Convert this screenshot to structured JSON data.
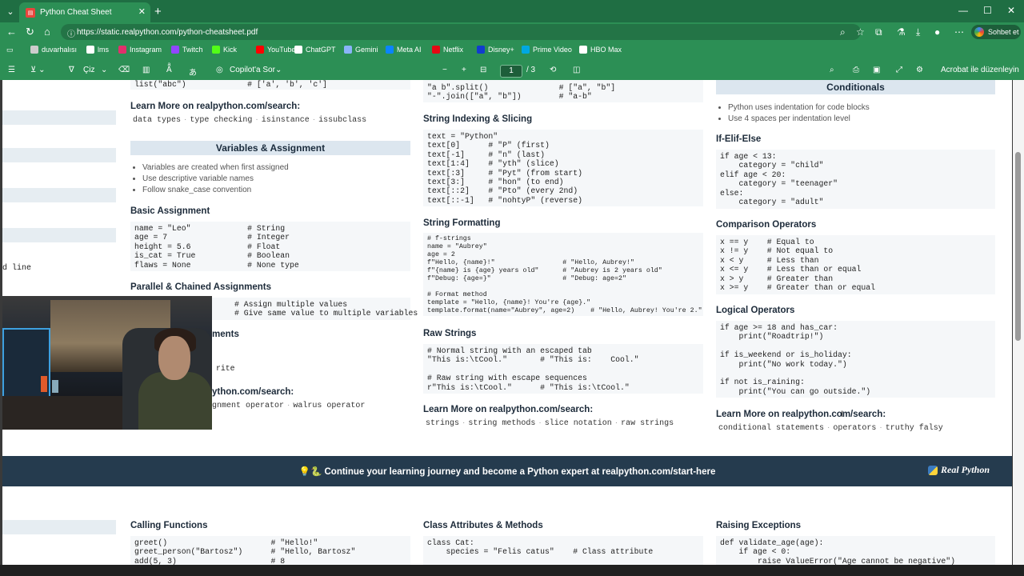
{
  "browser": {
    "tab_title": "Python Cheat Sheet",
    "url": "https://static.realpython.com/python-cheatsheet.pdf",
    "profile_label": "Sohbet et"
  },
  "bookmarks": [
    {
      "label": "duvarhalısı",
      "color": "#cccccc"
    },
    {
      "label": "lms",
      "color": "#ffffff"
    },
    {
      "label": "Instagram",
      "color": "#e1306c"
    },
    {
      "label": "Twitch",
      "color": "#9146ff"
    },
    {
      "label": "Kick",
      "color": "#53fc18"
    },
    {
      "label": "YouTube",
      "color": "#ff0000"
    },
    {
      "label": "ChatGPT",
      "color": "#ffffff"
    },
    {
      "label": "Gemini",
      "color": "#8ab4f8"
    },
    {
      "label": "Meta AI",
      "color": "#0a84ff"
    },
    {
      "label": "Netflix",
      "color": "#e50914"
    },
    {
      "label": "Disney+",
      "color": "#113ccf"
    },
    {
      "label": "Prime Video",
      "color": "#00a8e1"
    },
    {
      "label": "HBO Max",
      "color": "#ffffff"
    }
  ],
  "pdf_toolbar": {
    "draw_label": "Çiz",
    "copilot_label": "Copilot'a Sor",
    "page_current": "1",
    "page_total": "/ 3",
    "acrobat_label": "Acrobat ile düzenleyin"
  },
  "left_fragments": {
    "line_text": "d line",
    "search_fragment": "ython.com/search:",
    "ments": "ments",
    "rite": "rite",
    "tag_a": "gnment operator",
    "tag_b": "walrus operator"
  },
  "col1": {
    "top_code": "list(\"abc\")             # ['a', 'b', 'c']",
    "learn_title": "Learn More on realpython.com/search:",
    "tags": [
      "data types",
      "type checking",
      "isinstance",
      "issubclass"
    ],
    "section_title": "Variables & Assignment",
    "bullets": [
      "Variables are created when first assigned",
      "Use descriptive variable names",
      "Follow snake_case convention"
    ],
    "basic_title": "Basic Assignment",
    "basic_code": "name = \"Leo\"            # String\nage = 7                 # Integer\nheight = 5.6            # Float\nis_cat = True           # Boolean\nflaws = None            # None type",
    "parallel_title": "Parallel & Chained Assignments",
    "parallel_code": "# Assign multiple values\n# Give same value to multiple variables"
  },
  "col2": {
    "top_code": "\"a b\".split()               # [\"a\", \"b\"]\n\"-\".join([\"a\", \"b\"])        # \"a-b\"",
    "index_title": "String Indexing & Slicing",
    "index_code": "text = \"Python\"\ntext[0]      # \"P\" (first)\ntext[-1]     # \"n\" (last)\ntext[1:4]    # \"yth\" (slice)\ntext[:3]     # \"Pyt\" (from start)\ntext[3:]     # \"hon\" (to end)\ntext[::2]    # \"Pto\" (every 2nd)\ntext[::-1]   # \"nohtyP\" (reverse)",
    "format_title": "String Formatting",
    "format_code": "# f-strings\nname = \"Aubrey\"\nage = 2\nf\"Hello, {name}!\"                 # \"Hello, Aubrey!\"\nf\"{name} is {age} years old\"      # \"Aubrey is 2 years old\"\nf\"Debug: {age=}\"                  # \"Debug: age=2\"\n\n# Format method\ntemplate = \"Hello, {name}! You're {age}.\"\ntemplate.format(name=\"Aubrey\", age=2)    # \"Hello, Aubrey! You're 2.\"",
    "raw_title": "Raw Strings",
    "raw_code": "# Normal string with an escaped tab\n\"This is:\\tCool.\"       # \"This is:    Cool.\"\n\n# Raw string with escape sequences\nr\"This is:\\tCool.\"      # \"This is:\\tCool.\"",
    "learn_title": "Learn More on realpython.com/search:",
    "tags": [
      "strings",
      "string methods",
      "slice notation",
      "raw strings"
    ]
  },
  "col3": {
    "section_title": "Conditionals",
    "bullets": [
      "Python uses indentation for code blocks",
      "Use 4 spaces per indentation level"
    ],
    "ifelse_title": "If-Elif-Else",
    "ifelse_code": "if age < 13:\n    category = \"child\"\nelif age < 20:\n    category = \"teenager\"\nelse:\n    category = \"adult\"",
    "comp_title": "Comparison Operators",
    "comp_code": "x == y    # Equal to\nx != y    # Not equal to\nx < y     # Less than\nx <= y    # Less than or equal\nx > y     # Greater than\nx >= y    # Greater than or equal",
    "logic_title": "Logical Operators",
    "logic_code": "if age >= 18 and has_car:\n    print(\"Roadtrip!\")\n\nif is_weekend or is_holiday:\n    print(\"No work today.\")\n\nif not is_raining:\n    print(\"You can go outside.\")",
    "learn_title": "Learn More on realpython.com/search:",
    "tags": [
      "conditional statements",
      "operators",
      "truthy falsy"
    ]
  },
  "banner": {
    "text": "💡🐍 Continue your learning journey and become a Python expert at realpython.com/start-here",
    "logo": "Real Python"
  },
  "bottom": {
    "calling_title": "Calling Functions",
    "calling_code": "greet()                      # \"Hello!\"\ngreet_person(\"Bartosz\")      # \"Hello, Bartosz\"\nadd(5, 3)                    # 8",
    "class_title": "Class Attributes & Methods",
    "class_code": "class Cat:\n    species = \"Felis catus\"    # Class attribute",
    "raise_title": "Raising Exceptions",
    "raise_code": "def validate_age(age):\n    if age < 0:\n        raise ValueError(\"Age cannot be negative\")"
  }
}
